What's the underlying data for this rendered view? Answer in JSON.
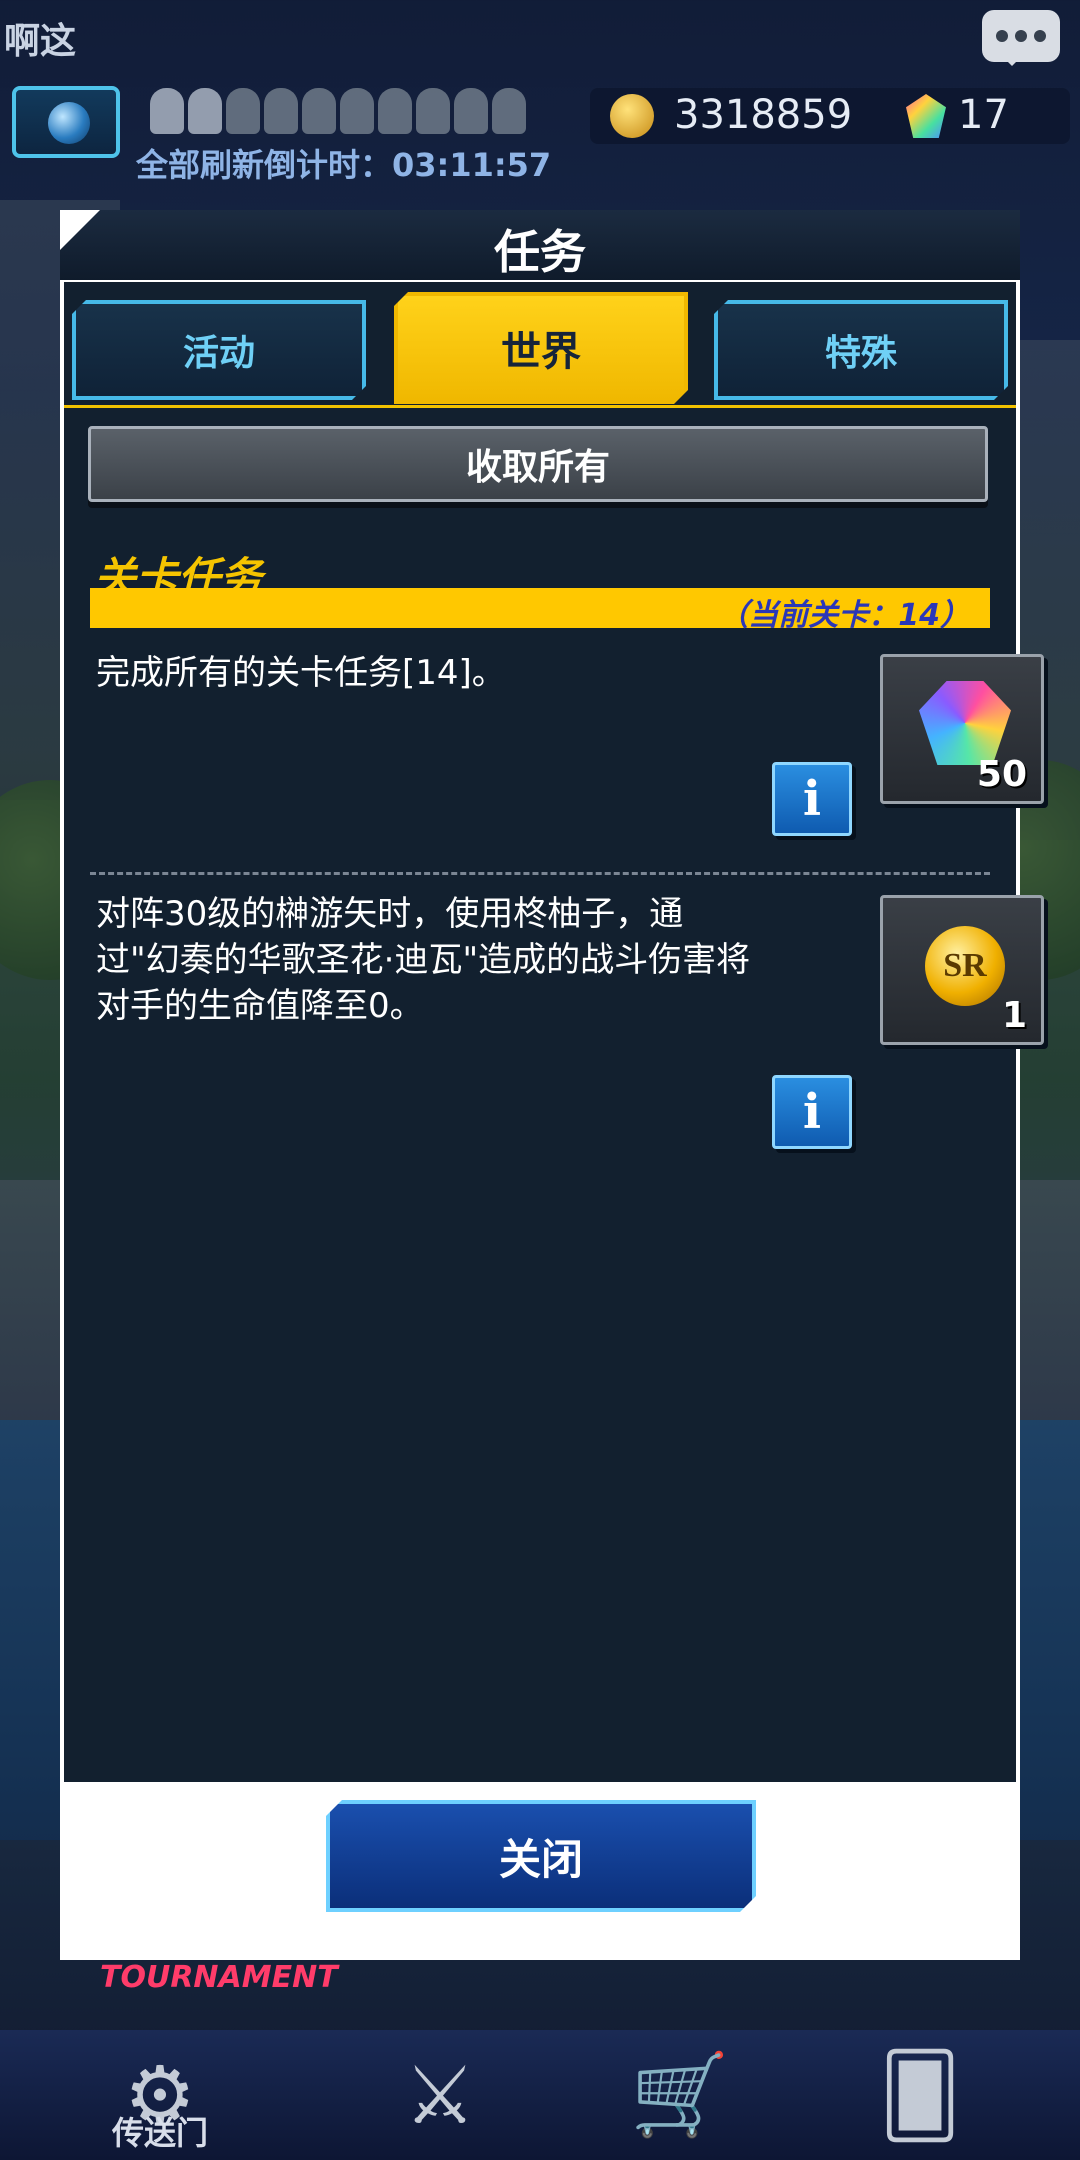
{
  "top_bar": {
    "player_name": "啊这",
    "refresh_countdown": "全部刷新倒计时：03:11:57",
    "gold": "3318859",
    "gems": "17"
  },
  "modal": {
    "title": "任务",
    "tabs": [
      {
        "label": "活动",
        "active": false
      },
      {
        "label": "世界",
        "active": true
      },
      {
        "label": "特殊",
        "active": false
      }
    ],
    "collect_all_label": "收取所有",
    "section_title": "关卡任务",
    "current_stage": "（当前关卡：14）",
    "missions": [
      {
        "text": "完成所有的关卡任务[14]。",
        "reward_icon": "gem-icon",
        "reward_qty": "50",
        "info_label": "i"
      },
      {
        "text": "对阵30级的榊游矢时，使用柊柚子，通过\"幻奏的华歌圣花·迪瓦\"造成的战斗伤害将对手的生命值降至0。",
        "reward_icon": "sr-ticket-icon",
        "reward_qty": "1",
        "reward_badge": "SR",
        "info_label": "i"
      }
    ],
    "close_label": "关闭"
  },
  "bottom_nav": {
    "tournament_label": "TOURNAMENT",
    "portal_label": "传送门",
    "items": [
      "portal-icon",
      "duel-icon",
      "shop-icon",
      "deck-icon"
    ]
  },
  "colors": {
    "accent_yellow": "#ffc800",
    "tab_border": "#46b9e8",
    "panel_bg": "#12202f",
    "close_button": "#1a4fae"
  }
}
